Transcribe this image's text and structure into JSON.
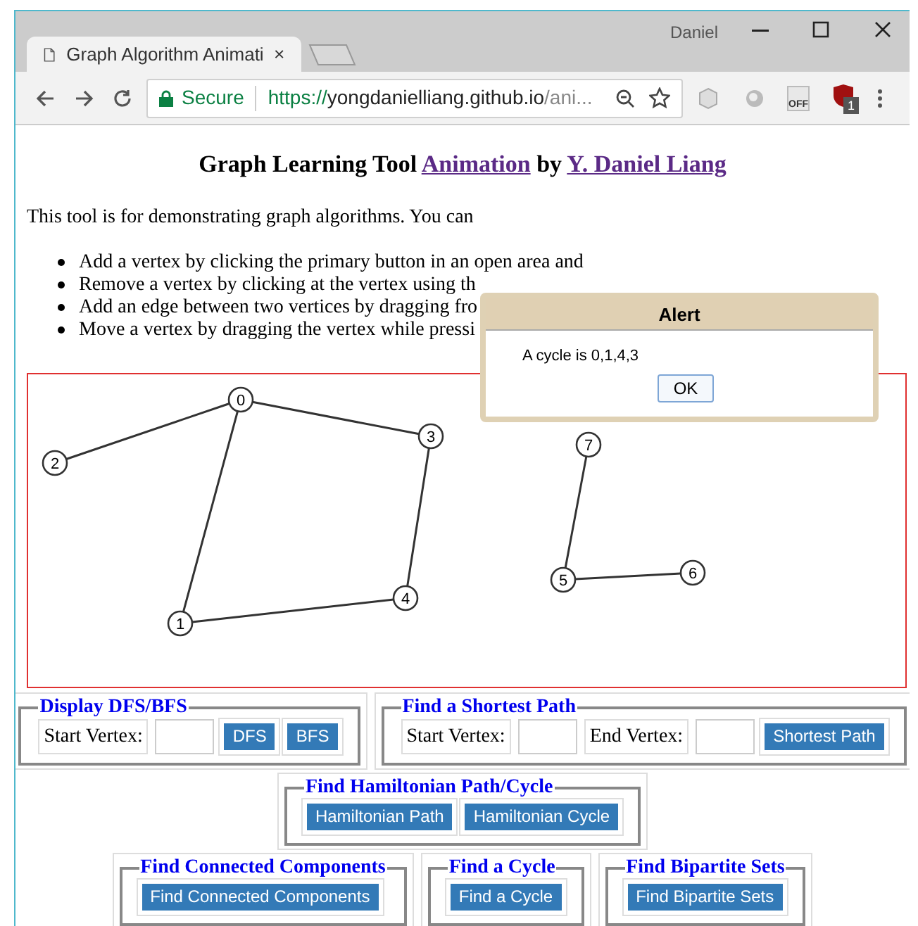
{
  "browser": {
    "tab_title": "Graph Algorithm Animati",
    "profile": "Daniel",
    "security": "Secure",
    "url_scheme": "https://",
    "url_host": "yongdanielliang.github.io",
    "url_path": "/ani...",
    "extension_label": "OFF",
    "extension_badge": "1"
  },
  "heading": {
    "prefix": "Graph Learning Tool",
    "link": "Animation",
    "middle": "by",
    "author": "Y. Daniel Liang"
  },
  "intro": "This tool is for demonstrating graph algorithms. You can",
  "instructions": [
    "Add a vertex by clicking the primary button in an open area and",
    "Remove a vertex by clicking at the vertex using th",
    "Add an edge between two vertices by dragging fro",
    "Move a vertex by dragging the vertex while pressi"
  ],
  "graph": {
    "vertices": [
      {
        "label": "0"
      },
      {
        "label": "1"
      },
      {
        "label": "2"
      },
      {
        "label": "3"
      },
      {
        "label": "4"
      },
      {
        "label": "5"
      },
      {
        "label": "6"
      },
      {
        "label": "7"
      }
    ]
  },
  "rows": [
    [
      {
        "legend": "Display DFS/BFS",
        "controls": [
          {
            "kind": "label",
            "text": "Start Vertex:"
          },
          {
            "kind": "input"
          },
          {
            "kind": "button",
            "text": "DFS"
          },
          {
            "kind": "button",
            "text": "BFS"
          }
        ]
      },
      {
        "legend": "Find a Shortest Path",
        "controls": [
          {
            "kind": "label",
            "text": "Start Vertex:"
          },
          {
            "kind": "input"
          },
          {
            "kind": "label",
            "text": "End Vertex:"
          },
          {
            "kind": "input"
          },
          {
            "kind": "button",
            "text": "Shortest Path"
          }
        ]
      }
    ],
    [
      {
        "legend": "Find Hamiltonian Path/Cycle",
        "controls": [
          {
            "kind": "button",
            "text": "Hamiltonian Path"
          },
          {
            "kind": "button",
            "text": "Hamiltonian Cycle"
          }
        ]
      }
    ],
    [
      {
        "legend": "Find Connected Components",
        "controls": [
          {
            "kind": "button",
            "text": "Find Connected Components"
          }
        ]
      },
      {
        "legend": "Find a Cycle",
        "controls": [
          {
            "kind": "button",
            "text": "Find a Cycle"
          }
        ]
      },
      {
        "legend": "Find Bipartite Sets",
        "controls": [
          {
            "kind": "button",
            "text": "Find Bipartite Sets"
          }
        ]
      }
    ]
  ],
  "alert": {
    "title": "Alert",
    "message": "A cycle is 0,1,4,3",
    "button": "OK"
  }
}
